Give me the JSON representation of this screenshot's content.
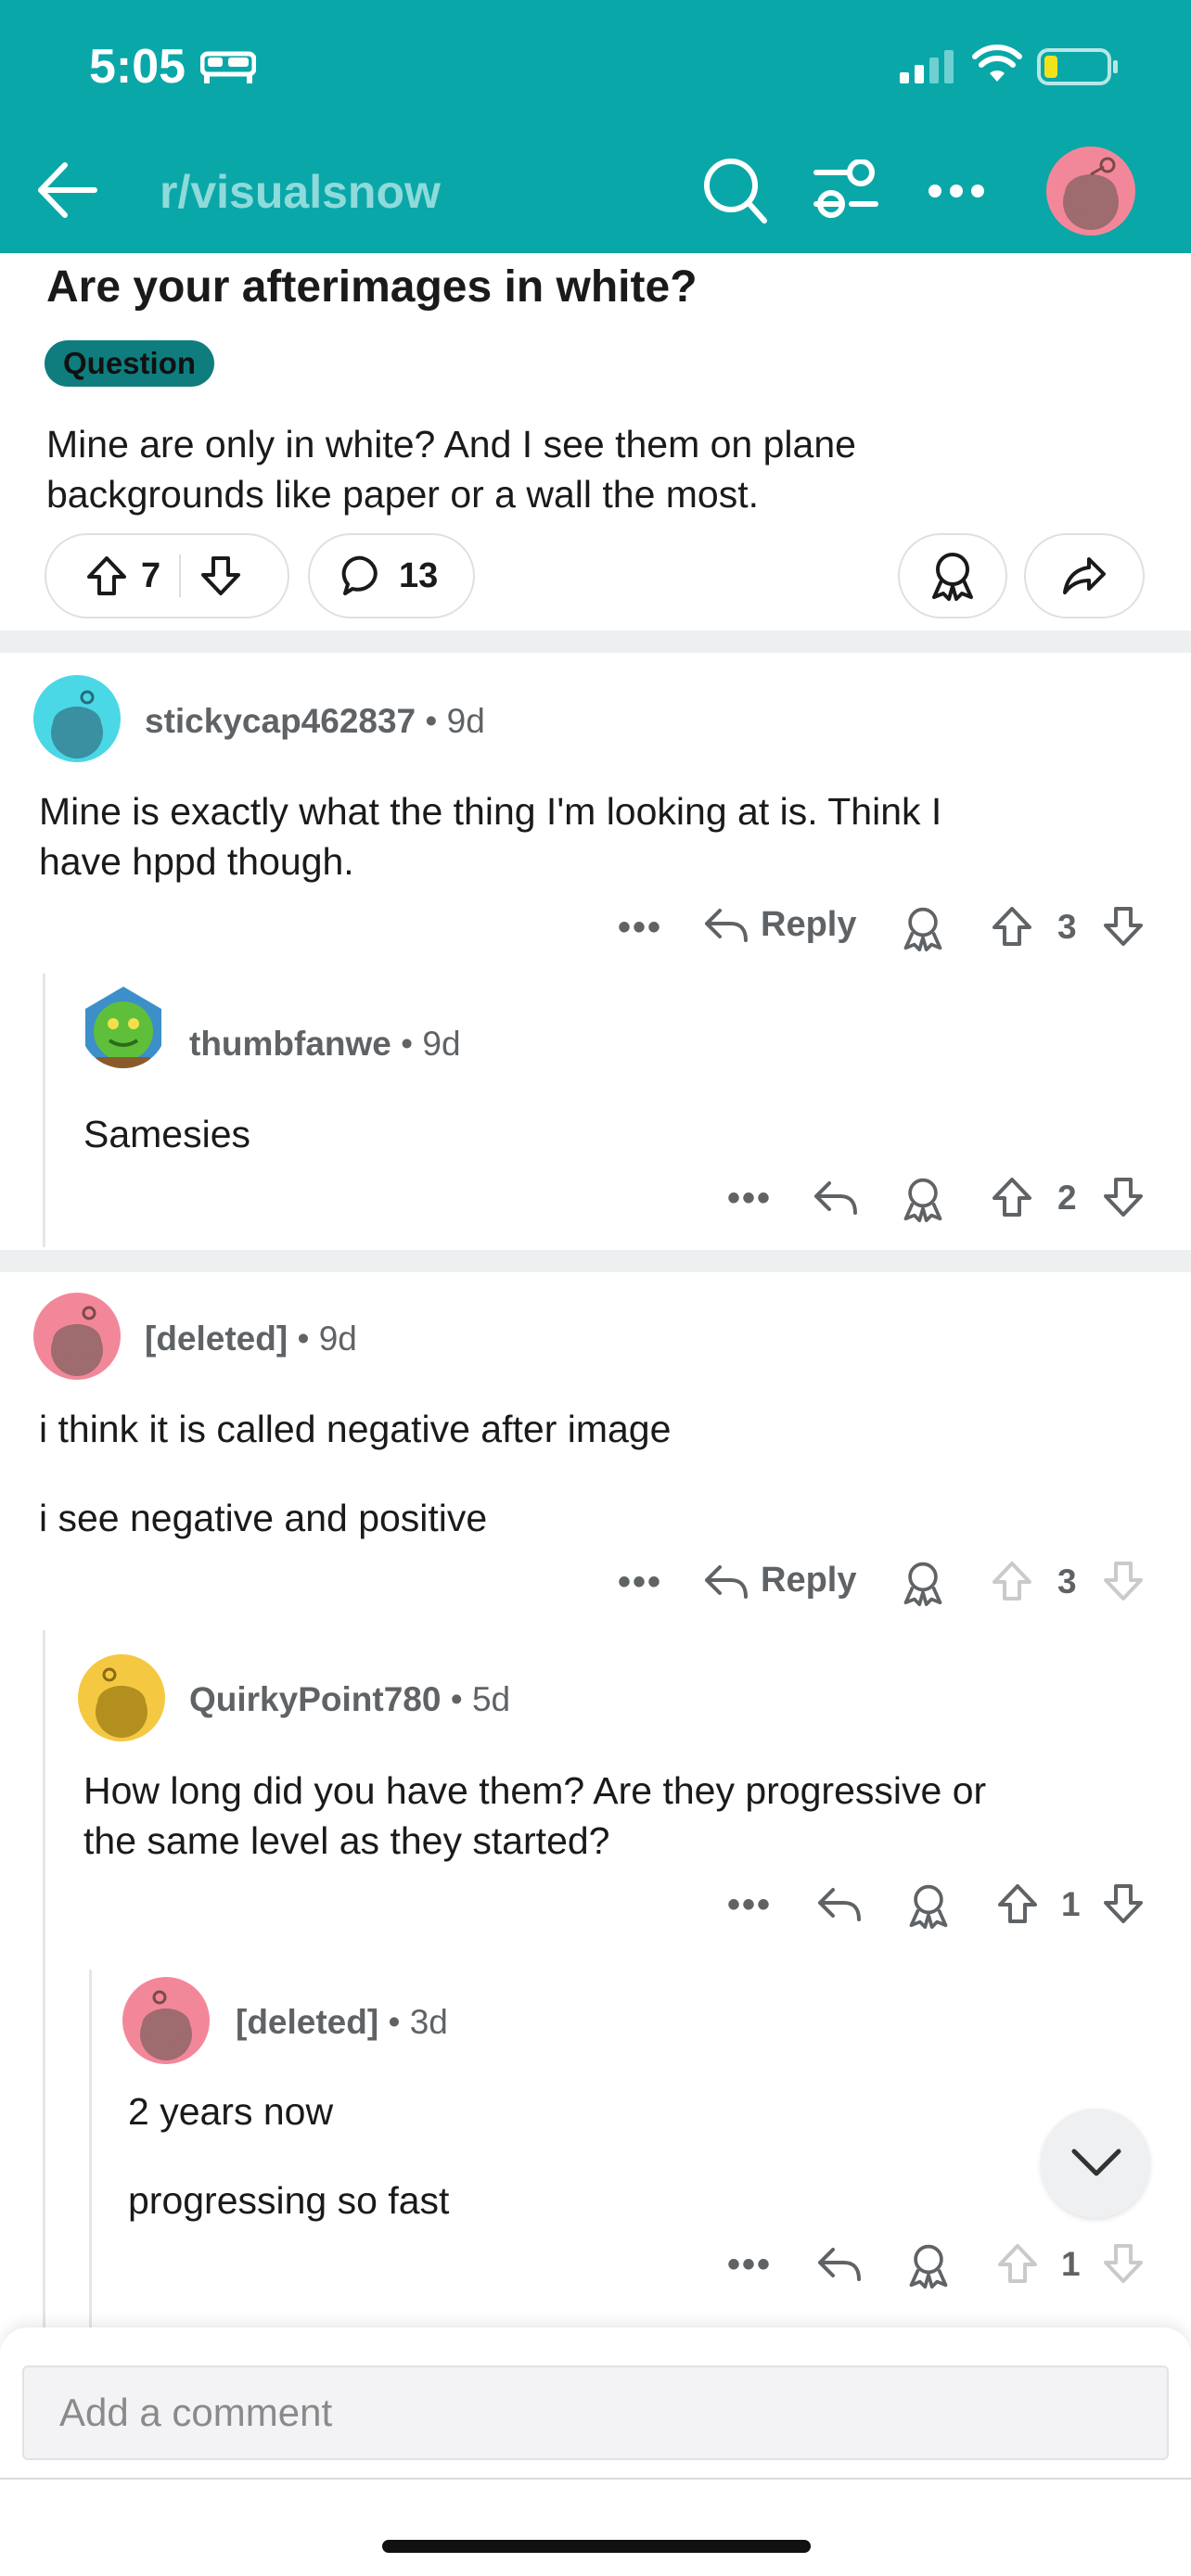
{
  "status_bar": {
    "time": "5:05"
  },
  "nav": {
    "subreddit": "r/visualsnow"
  },
  "post": {
    "title": "Are your afterimages in white?",
    "flair": "Question",
    "body_line1": "Mine are only in white? And I see them on plane",
    "body_line2": "backgrounds like paper or a wall the most.",
    "upvotes": "7",
    "comments": "13"
  },
  "comments": [
    {
      "user": "stickycap462837",
      "age": "9d",
      "line1": "Mine is exactly what the thing I'm looking at is. Think I",
      "line2": "have hppd though.",
      "reply_label": "Reply",
      "score": "3"
    },
    {
      "user": "thumbfanwe",
      "age": "9d",
      "line1": "Samesies",
      "score": "2"
    },
    {
      "user": "[deleted]",
      "age": "9d",
      "line1": "i think it is called negative after image",
      "line2": "i see negative and positive",
      "reply_label": "Reply",
      "score": "3"
    },
    {
      "user": "QuirkyPoint780",
      "age": "5d",
      "line1": "How long did you have them? Are they progressive or",
      "line2": "the same level as they started?",
      "score": "1"
    },
    {
      "user": "[deleted]",
      "age": "3d",
      "line1": "2 years now",
      "line2": "progressing so fast",
      "score": "1"
    }
  ],
  "separator": "•",
  "more_glyph": "•••",
  "composer": {
    "placeholder": "Add a comment"
  },
  "colors": {
    "header": "#0aa7a8",
    "flair": "#0f7d7e",
    "text": "#1a1a1b",
    "meta": "#5f6366"
  },
  "icons": [
    "bed-icon",
    "signal-icon",
    "wifi-icon",
    "battery-icon",
    "back-arrow-icon",
    "search-icon",
    "filter-icon",
    "more-icon",
    "avatar-icon",
    "upvote-icon",
    "downvote-icon",
    "comment-icon",
    "award-icon",
    "share-icon",
    "reply-icon",
    "chevron-down-icon"
  ]
}
